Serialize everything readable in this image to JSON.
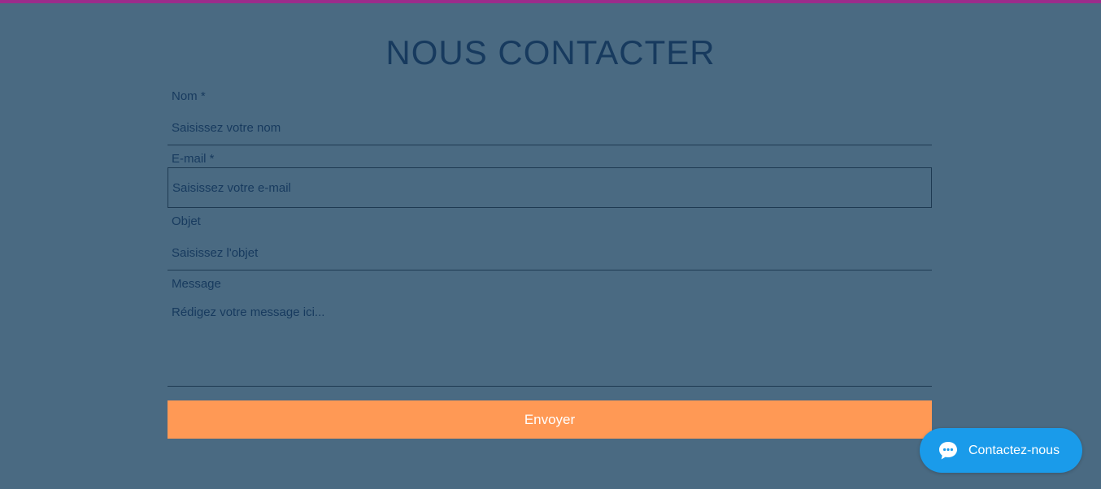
{
  "page": {
    "title": "NOUS CONTACTER"
  },
  "form": {
    "name": {
      "label": "Nom *",
      "placeholder": "Saisissez votre nom"
    },
    "email": {
      "label": "E-mail *",
      "placeholder": "Saisissez votre e-mail"
    },
    "subject": {
      "label": "Objet",
      "placeholder": "Saisissez l'objet"
    },
    "message": {
      "label": "Message",
      "placeholder": "Rédigez votre message ici..."
    },
    "submit_label": "Envoyer"
  },
  "chat": {
    "label": "Contactez-nous",
    "icon": "chat-bubble-icon"
  },
  "colors": {
    "background": "#4A6A82",
    "accent_bar": "#9B2C8B",
    "text": "#173A5E",
    "submit": "#FF9955",
    "chat": "#1A9BEA"
  }
}
